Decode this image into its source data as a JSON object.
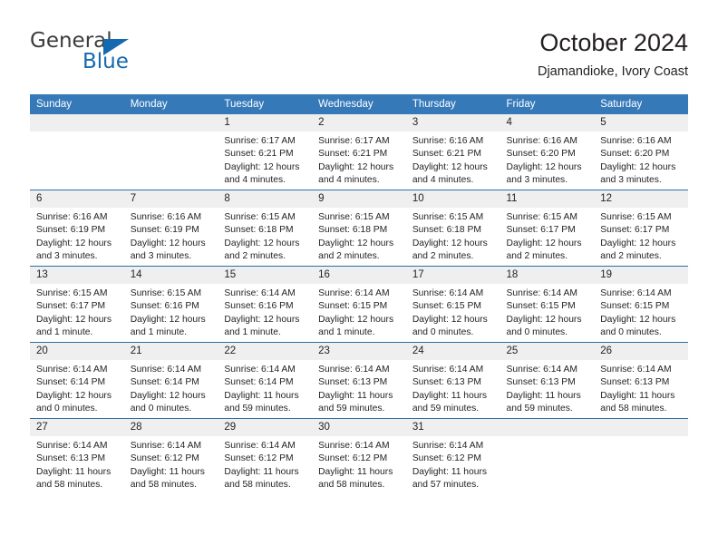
{
  "brand": {
    "name_part1": "General",
    "name_part2": "Blue",
    "accent_color": "#1569b0",
    "triangle_icon": "triangle-icon"
  },
  "header": {
    "title": "October 2024",
    "location": "Djamandioke, Ivory Coast"
  },
  "calendar": {
    "header_bg": "#3679b9",
    "daynum_bg": "#efefef",
    "row_divider_color": "#2e6da4",
    "weekday_headers": [
      "Sunday",
      "Monday",
      "Tuesday",
      "Wednesday",
      "Thursday",
      "Friday",
      "Saturday"
    ],
    "weeks": [
      [
        {
          "day": "",
          "empty": true,
          "lines": []
        },
        {
          "day": "",
          "empty": true,
          "lines": []
        },
        {
          "day": "1",
          "lines": [
            "Sunrise: 6:17 AM",
            "Sunset: 6:21 PM",
            "Daylight: 12 hours",
            "and 4 minutes."
          ]
        },
        {
          "day": "2",
          "lines": [
            "Sunrise: 6:17 AM",
            "Sunset: 6:21 PM",
            "Daylight: 12 hours",
            "and 4 minutes."
          ]
        },
        {
          "day": "3",
          "lines": [
            "Sunrise: 6:16 AM",
            "Sunset: 6:21 PM",
            "Daylight: 12 hours",
            "and 4 minutes."
          ]
        },
        {
          "day": "4",
          "lines": [
            "Sunrise: 6:16 AM",
            "Sunset: 6:20 PM",
            "Daylight: 12 hours",
            "and 3 minutes."
          ]
        },
        {
          "day": "5",
          "lines": [
            "Sunrise: 6:16 AM",
            "Sunset: 6:20 PM",
            "Daylight: 12 hours",
            "and 3 minutes."
          ]
        }
      ],
      [
        {
          "day": "6",
          "lines": [
            "Sunrise: 6:16 AM",
            "Sunset: 6:19 PM",
            "Daylight: 12 hours",
            "and 3 minutes."
          ]
        },
        {
          "day": "7",
          "lines": [
            "Sunrise: 6:16 AM",
            "Sunset: 6:19 PM",
            "Daylight: 12 hours",
            "and 3 minutes."
          ]
        },
        {
          "day": "8",
          "lines": [
            "Sunrise: 6:15 AM",
            "Sunset: 6:18 PM",
            "Daylight: 12 hours",
            "and 2 minutes."
          ]
        },
        {
          "day": "9",
          "lines": [
            "Sunrise: 6:15 AM",
            "Sunset: 6:18 PM",
            "Daylight: 12 hours",
            "and 2 minutes."
          ]
        },
        {
          "day": "10",
          "lines": [
            "Sunrise: 6:15 AM",
            "Sunset: 6:18 PM",
            "Daylight: 12 hours",
            "and 2 minutes."
          ]
        },
        {
          "day": "11",
          "lines": [
            "Sunrise: 6:15 AM",
            "Sunset: 6:17 PM",
            "Daylight: 12 hours",
            "and 2 minutes."
          ]
        },
        {
          "day": "12",
          "lines": [
            "Sunrise: 6:15 AM",
            "Sunset: 6:17 PM",
            "Daylight: 12 hours",
            "and 2 minutes."
          ]
        }
      ],
      [
        {
          "day": "13",
          "lines": [
            "Sunrise: 6:15 AM",
            "Sunset: 6:17 PM",
            "Daylight: 12 hours",
            "and 1 minute."
          ]
        },
        {
          "day": "14",
          "lines": [
            "Sunrise: 6:15 AM",
            "Sunset: 6:16 PM",
            "Daylight: 12 hours",
            "and 1 minute."
          ]
        },
        {
          "day": "15",
          "lines": [
            "Sunrise: 6:14 AM",
            "Sunset: 6:16 PM",
            "Daylight: 12 hours",
            "and 1 minute."
          ]
        },
        {
          "day": "16",
          "lines": [
            "Sunrise: 6:14 AM",
            "Sunset: 6:15 PM",
            "Daylight: 12 hours",
            "and 1 minute."
          ]
        },
        {
          "day": "17",
          "lines": [
            "Sunrise: 6:14 AM",
            "Sunset: 6:15 PM",
            "Daylight: 12 hours",
            "and 0 minutes."
          ]
        },
        {
          "day": "18",
          "lines": [
            "Sunrise: 6:14 AM",
            "Sunset: 6:15 PM",
            "Daylight: 12 hours",
            "and 0 minutes."
          ]
        },
        {
          "day": "19",
          "lines": [
            "Sunrise: 6:14 AM",
            "Sunset: 6:15 PM",
            "Daylight: 12 hours",
            "and 0 minutes."
          ]
        }
      ],
      [
        {
          "day": "20",
          "lines": [
            "Sunrise: 6:14 AM",
            "Sunset: 6:14 PM",
            "Daylight: 12 hours",
            "and 0 minutes."
          ]
        },
        {
          "day": "21",
          "lines": [
            "Sunrise: 6:14 AM",
            "Sunset: 6:14 PM",
            "Daylight: 12 hours",
            "and 0 minutes."
          ]
        },
        {
          "day": "22",
          "lines": [
            "Sunrise: 6:14 AM",
            "Sunset: 6:14 PM",
            "Daylight: 11 hours",
            "and 59 minutes."
          ]
        },
        {
          "day": "23",
          "lines": [
            "Sunrise: 6:14 AM",
            "Sunset: 6:13 PM",
            "Daylight: 11 hours",
            "and 59 minutes."
          ]
        },
        {
          "day": "24",
          "lines": [
            "Sunrise: 6:14 AM",
            "Sunset: 6:13 PM",
            "Daylight: 11 hours",
            "and 59 minutes."
          ]
        },
        {
          "day": "25",
          "lines": [
            "Sunrise: 6:14 AM",
            "Sunset: 6:13 PM",
            "Daylight: 11 hours",
            "and 59 minutes."
          ]
        },
        {
          "day": "26",
          "lines": [
            "Sunrise: 6:14 AM",
            "Sunset: 6:13 PM",
            "Daylight: 11 hours",
            "and 58 minutes."
          ]
        }
      ],
      [
        {
          "day": "27",
          "lines": [
            "Sunrise: 6:14 AM",
            "Sunset: 6:13 PM",
            "Daylight: 11 hours",
            "and 58 minutes."
          ]
        },
        {
          "day": "28",
          "lines": [
            "Sunrise: 6:14 AM",
            "Sunset: 6:12 PM",
            "Daylight: 11 hours",
            "and 58 minutes."
          ]
        },
        {
          "day": "29",
          "lines": [
            "Sunrise: 6:14 AM",
            "Sunset: 6:12 PM",
            "Daylight: 11 hours",
            "and 58 minutes."
          ]
        },
        {
          "day": "30",
          "lines": [
            "Sunrise: 6:14 AM",
            "Sunset: 6:12 PM",
            "Daylight: 11 hours",
            "and 58 minutes."
          ]
        },
        {
          "day": "31",
          "lines": [
            "Sunrise: 6:14 AM",
            "Sunset: 6:12 PM",
            "Daylight: 11 hours",
            "and 57 minutes."
          ]
        },
        {
          "day": "",
          "empty": true,
          "lines": []
        },
        {
          "day": "",
          "empty": true,
          "lines": []
        }
      ]
    ]
  }
}
